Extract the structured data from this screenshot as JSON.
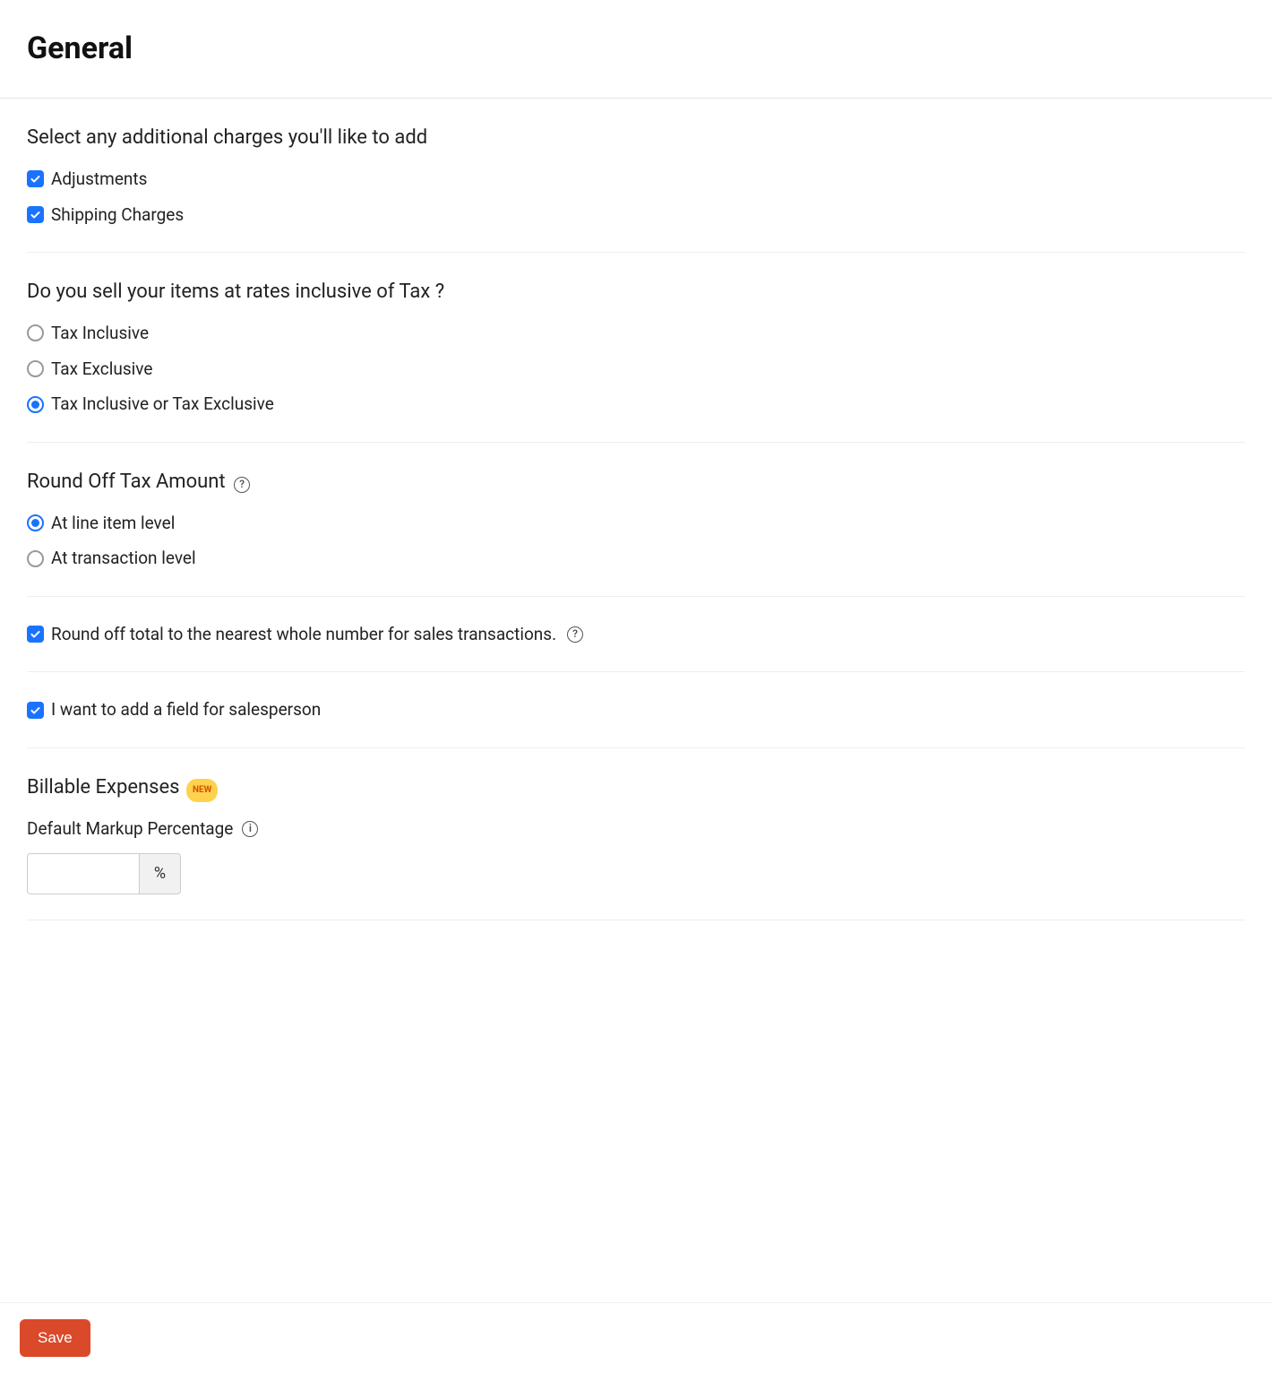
{
  "header": {
    "title": "General"
  },
  "charges": {
    "heading": "Select any additional charges you'll like to add",
    "adjustments": {
      "label": "Adjustments",
      "checked": true
    },
    "shipping": {
      "label": "Shipping Charges",
      "checked": true
    }
  },
  "tax_inclusive": {
    "heading": "Do you sell your items at rates inclusive of Tax ?",
    "options": [
      {
        "label": "Tax Inclusive",
        "selected": false
      },
      {
        "label": "Tax Exclusive",
        "selected": false
      },
      {
        "label": "Tax Inclusive or Tax Exclusive",
        "selected": true
      }
    ]
  },
  "round_off_tax": {
    "heading": "Round Off Tax Amount",
    "options": [
      {
        "label": "At line item level",
        "selected": true
      },
      {
        "label": "At transaction level",
        "selected": false
      }
    ]
  },
  "round_total": {
    "label": "Round off total to the nearest whole number for sales transactions.",
    "checked": true
  },
  "salesperson": {
    "label": "I want to add a field for salesperson",
    "checked": true
  },
  "billable": {
    "heading": "Billable Expenses",
    "badge": "NEW",
    "markup_label": "Default Markup Percentage",
    "markup_value": "",
    "markup_suffix": "%"
  },
  "footer": {
    "save_label": "Save"
  },
  "glyphs": {
    "help": "?",
    "info": "i"
  }
}
